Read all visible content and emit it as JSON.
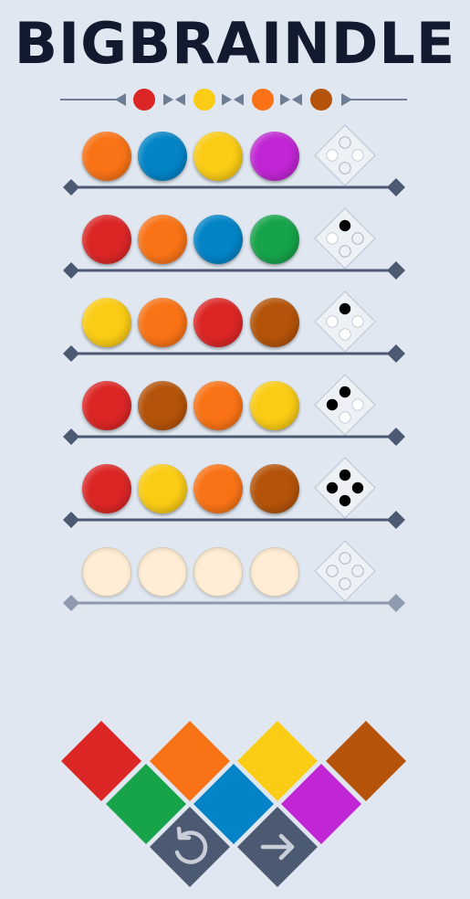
{
  "title": "BIGBRAINDLE",
  "colors": {
    "red": "#dc2626",
    "orange": "#f97316",
    "blue": "#0284c7",
    "yellow": "#facc15",
    "purple": "#c026d3",
    "green": "#16a34a",
    "brown": "#b45309",
    "empty": "#ffedd5",
    "slate": "#4b5a72",
    "line": "#6d7d96"
  },
  "legend_pegs": [
    "red",
    "yellow",
    "orange",
    "brown"
  ],
  "guesses": [
    {
      "pegs": [
        "orange",
        "blue",
        "yellow",
        "purple"
      ],
      "feedback": [
        "empty",
        "white",
        "white",
        "empty"
      ]
    },
    {
      "pegs": [
        "red",
        "orange",
        "blue",
        "green"
      ],
      "feedback": [
        "black",
        "white",
        "empty",
        "empty"
      ]
    },
    {
      "pegs": [
        "yellow",
        "orange",
        "red",
        "brown"
      ],
      "feedback": [
        "black",
        "white",
        "white",
        "white"
      ]
    },
    {
      "pegs": [
        "red",
        "brown",
        "orange",
        "yellow"
      ],
      "feedback": [
        "black",
        "black",
        "white",
        "white"
      ]
    },
    {
      "pegs": [
        "red",
        "yellow",
        "orange",
        "brown"
      ],
      "feedback": [
        "black",
        "black",
        "black",
        "black"
      ]
    },
    {
      "pegs": [
        "empty",
        "empty",
        "empty",
        "empty"
      ],
      "feedback": [
        "none",
        "none",
        "none",
        "none"
      ]
    }
  ],
  "keypad": {
    "top_row": [
      "red",
      "orange",
      "yellow",
      "brown"
    ],
    "middle_row": [
      "green",
      "blue",
      "purple"
    ],
    "bottom_row": [
      {
        "action": "undo",
        "icon": "undo-icon"
      },
      {
        "action": "submit",
        "icon": "arrow-right-icon"
      }
    ]
  }
}
